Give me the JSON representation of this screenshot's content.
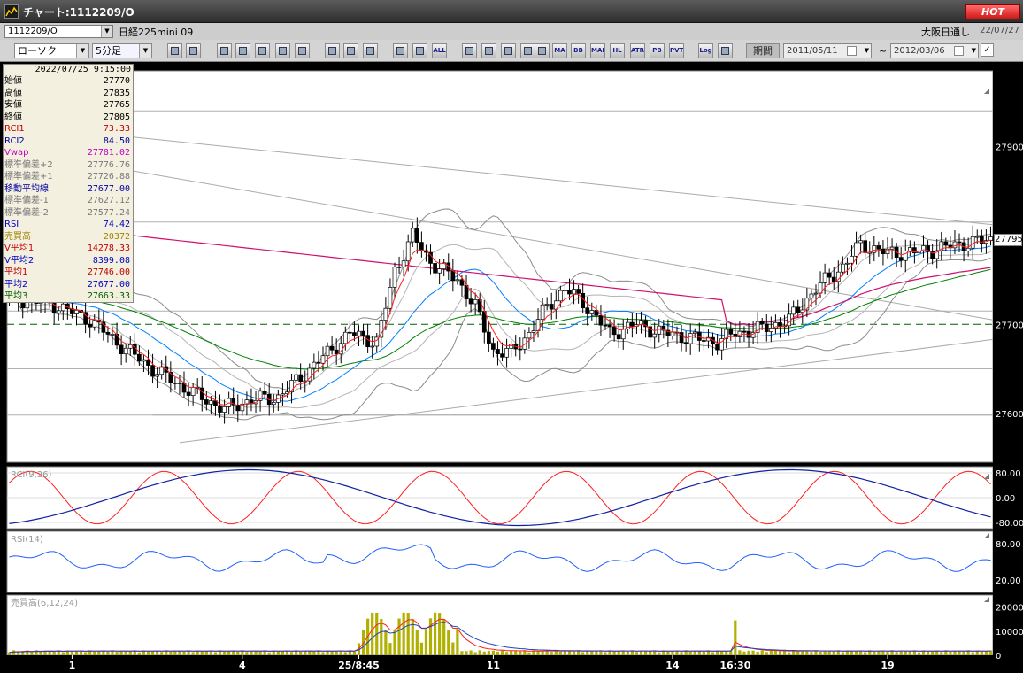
{
  "window": {
    "title": "チャート:1112209/O",
    "hot_label": "HOT"
  },
  "infobar": {
    "symbol": "1112209/O",
    "instrument": "日経225mini 09",
    "session": "大阪日通し",
    "date": "22/07/27"
  },
  "toolbar": {
    "chart_type": "ローソク",
    "interval": "5分足",
    "buttons": [
      {
        "name": "zoom-icon",
        "label": ""
      },
      {
        "name": "crosshair-icon",
        "label": ""
      },
      {
        "name": "candle-tool-icon",
        "label": ""
      },
      {
        "name": "search-tool-icon",
        "label": ""
      },
      {
        "name": "bar-tool-icon",
        "label": ""
      },
      {
        "name": "compare-icon",
        "label": ""
      },
      {
        "name": "alert-icon",
        "label": ""
      },
      {
        "name": "pen-icon",
        "label": ""
      },
      {
        "name": "cursor-icon",
        "label": ""
      },
      {
        "name": "undo-icon",
        "label": ""
      },
      {
        "name": "marker-left-icon",
        "label": ""
      },
      {
        "name": "marker-right-icon",
        "label": ""
      },
      {
        "name": "all-button",
        "label": "ALL"
      },
      {
        "name": "settings-icon",
        "label": ""
      },
      {
        "name": "tools-icon",
        "label": ""
      },
      {
        "name": "stamp-icon",
        "label": ""
      },
      {
        "name": "color-icon",
        "label": ""
      },
      {
        "name": "table-icon",
        "label": ""
      },
      {
        "name": "ma-button",
        "label": "MA"
      },
      {
        "name": "bb-button",
        "label": "BB"
      },
      {
        "name": "mae-button",
        "label": "MAE"
      },
      {
        "name": "hl-button",
        "label": "HL"
      },
      {
        "name": "atr-button",
        "label": "ATR"
      },
      {
        "name": "pb-button",
        "label": "PB"
      },
      {
        "name": "pvt-button",
        "label": "PVT"
      },
      {
        "name": "log-button",
        "label": "Log"
      },
      {
        "name": "export-icon",
        "label": ""
      }
    ],
    "period_label": "期間",
    "date_from": "2011/05/11",
    "date_sep": "~",
    "date_to": "2012/03/06",
    "check_mark": "✓"
  },
  "info_panel": {
    "timestamp": "2022/07/25 9:15:00",
    "rows": [
      {
        "label": "始値",
        "value": "27770",
        "color": "#000000"
      },
      {
        "label": "高値",
        "value": "27835",
        "color": "#000000"
      },
      {
        "label": "安値",
        "value": "27765",
        "color": "#000000"
      },
      {
        "label": "終値",
        "value": "27805",
        "color": "#000000"
      },
      {
        "label": "RCI1",
        "value": "73.33",
        "color": "#c00000"
      },
      {
        "label": "RCI2",
        "value": "84.50",
        "color": "#0000a0"
      },
      {
        "label": "Vwap",
        "value": "27781.02",
        "color": "#c000c0"
      },
      {
        "label": "標準偏差+2",
        "value": "27776.76",
        "color": "#777777"
      },
      {
        "label": "標準偏差+1",
        "value": "27726.88",
        "color": "#777777"
      },
      {
        "label": "移動平均線",
        "value": "27677.00",
        "color": "#0000a0"
      },
      {
        "label": "標準偏差-1",
        "value": "27627.12",
        "color": "#777777"
      },
      {
        "label": "標準偏差-2",
        "value": "27577.24",
        "color": "#777777"
      },
      {
        "label": "RSI",
        "value": "74.42",
        "color": "#0000c0"
      },
      {
        "label": "売買高",
        "value": "20372",
        "color": "#a08000"
      },
      {
        "label": "V平均1",
        "value": "14278.33",
        "color": "#c00000"
      },
      {
        "label": "V平均2",
        "value": "8399.08",
        "color": "#0000c0"
      },
      {
        "label": "平均1",
        "value": "27746.00",
        "color": "#c00000"
      },
      {
        "label": "平均2",
        "value": "27677.00",
        "color": "#0000c0"
      },
      {
        "label": "平均3",
        "value": "27663.33",
        "color": "#006000"
      }
    ]
  },
  "price_axis": {
    "ticks": [
      {
        "value": 27900,
        "label": "27900"
      },
      {
        "value": 27700,
        "label": "27700"
      },
      {
        "value": 27600,
        "label": "27600"
      }
    ],
    "last_price": "27795"
  },
  "panels": {
    "rci": {
      "label": "RCI(9,26)",
      "ticks": [
        {
          "value": 80,
          "label": "80.00"
        },
        {
          "value": 0,
          "label": "0.00"
        },
        {
          "value": -80,
          "label": "-80.00"
        }
      ]
    },
    "rsi": {
      "label": "RSI(14)",
      "ticks": [
        {
          "value": 80,
          "label": "80.00"
        },
        {
          "value": 20,
          "label": "20.00"
        }
      ]
    },
    "volume": {
      "label": "売買高(6,12,24)",
      "ticks": [
        {
          "value": 20000,
          "label": "20000"
        },
        {
          "value": 10000,
          "label": "10000"
        },
        {
          "value": 0,
          "label": "0"
        }
      ]
    }
  },
  "x_axis": {
    "labels": [
      {
        "index": 14,
        "label": "1"
      },
      {
        "index": 52,
        "label": "4"
      },
      {
        "index": 78,
        "label": "25/8:45"
      },
      {
        "index": 108,
        "label": "11"
      },
      {
        "index": 148,
        "label": "14"
      },
      {
        "index": 162,
        "label": "16:30"
      },
      {
        "index": 196,
        "label": "19"
      }
    ]
  },
  "colors": {
    "up_candle": "#ffffff",
    "down_candle": "#000000",
    "vwap": "#d01070",
    "sma": "#0080ff",
    "ema_red": "#ff2020",
    "ema_green": "#008000",
    "band": "#a0a0a0",
    "rci_fast": "#ff2020",
    "rci_slow": "#1020a0",
    "rsi": "#2060ff",
    "volume": "#b0b000",
    "dashed_level": "#006000"
  }
}
